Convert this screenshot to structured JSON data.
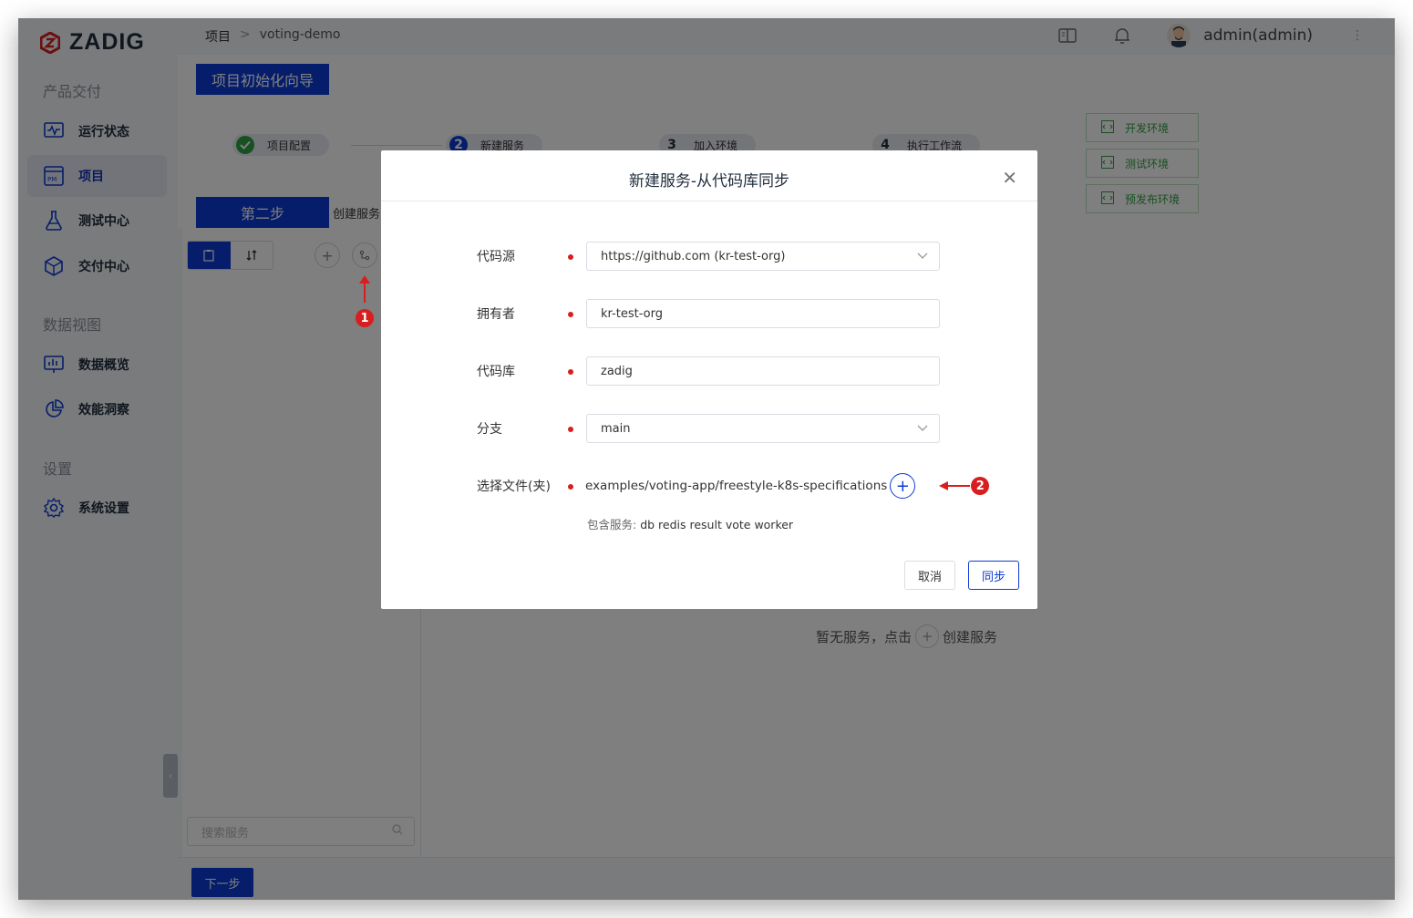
{
  "app": {
    "logo_text": "ZADIG"
  },
  "sidebar": {
    "sections": [
      {
        "title": "产品交付"
      },
      {
        "title": "数据视图"
      },
      {
        "title": "设置"
      }
    ],
    "items": [
      {
        "label": "运行状态",
        "icon": "pulse-monitor-icon"
      },
      {
        "label": "项目",
        "icon": "project-pm-icon",
        "active": true
      },
      {
        "label": "测试中心",
        "icon": "flask-icon"
      },
      {
        "label": "交付中心",
        "icon": "package-icon"
      },
      {
        "label": "数据概览",
        "icon": "dashboard-icon"
      },
      {
        "label": "效能洞察",
        "icon": "pie-chart-icon"
      },
      {
        "label": "系统设置",
        "icon": "gear-icon"
      }
    ]
  },
  "topbar": {
    "breadcrumb": {
      "root": "项目",
      "sep": ">",
      "current": "voting-demo"
    },
    "user": "admin(admin)"
  },
  "wizard": {
    "title_button": "项目初始化向导",
    "steps": [
      {
        "num": "",
        "label": "项目配置",
        "state": "done"
      },
      {
        "num": "2",
        "label": "新建服务",
        "state": "current"
      },
      {
        "num": "3",
        "label": "加入环境",
        "state": "todo"
      },
      {
        "num": "4",
        "label": "执行工作流",
        "state": "todo"
      }
    ],
    "step_button": "第二步",
    "step_text": "创建服务",
    "envs": [
      "开发环境",
      "测试环境",
      "预发布环境"
    ]
  },
  "services": {
    "search_placeholder": "搜索服务",
    "empty_prefix": "暂无服务，点击",
    "empty_suffix": "创建服务",
    "next_button": "下一步"
  },
  "annotations": {
    "one": "1",
    "two": "2",
    "color": "#d81e1e"
  },
  "modal": {
    "title": "新建服务-从代码库同步",
    "source_label": "代码源",
    "source_value": "https://github.com (kr-test-org)",
    "owner_label": "拥有者",
    "owner_value": "kr-test-org",
    "repo_label": "代码库",
    "repo_value": "zadig",
    "branch_label": "分支",
    "branch_value": "main",
    "path_label": "选择文件(夹)",
    "path_value": "examples/voting-app/freestyle-k8s-specifications",
    "includes_key": "包含服务:",
    "includes_value": "db redis result vote worker",
    "cancel": "取消",
    "sync": "同步"
  },
  "colors": {
    "primary": "#0b3bd4",
    "success": "#2ea043",
    "danger": "#d81e1e"
  }
}
